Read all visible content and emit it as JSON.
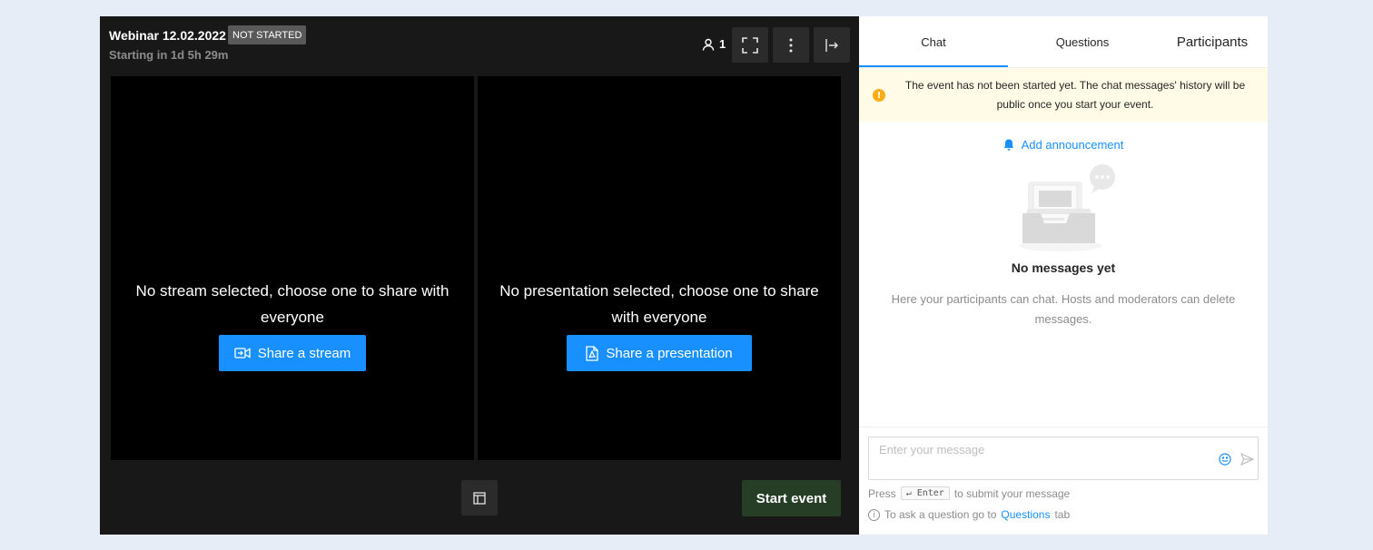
{
  "stage": {
    "title": "Webinar 12.02.2022",
    "status_badge": "NOT STARTED",
    "countdown": "Starting in 1d 5h 29m",
    "viewer_count": "1",
    "stream_pane": {
      "message": "No stream selected, choose one to share with everyone",
      "button": "Share a stream"
    },
    "presentation_pane": {
      "message": "No presentation selected, choose one to share with everyone",
      "button": "Share a presentation"
    },
    "start_button": "Start event"
  },
  "panel": {
    "tabs": [
      {
        "label": "Chat",
        "active": true
      },
      {
        "label": "Questions",
        "active": false
      },
      {
        "label": "Participants",
        "active": false
      }
    ],
    "warning": "The event has not been started yet. The chat messages' history will be public once you start your event.",
    "announcement": "Add announcement",
    "empty_title": "No messages yet",
    "empty_description": "Here your participants can chat. Hosts and moderators can delete messages.",
    "composer": {
      "placeholder": "Enter your message",
      "value": ""
    },
    "hint": {
      "press": "Press",
      "key": "↵ Enter",
      "rest": "to submit your message"
    },
    "info": {
      "prefix": "To ask a question go to",
      "link": "Questions",
      "suffix": "tab"
    }
  },
  "colors": {
    "accent": "#1890ff",
    "stage_bg": "#181818",
    "start_button": "#263d26",
    "warning_bg": "#fffbe6",
    "warning_icon": "#faad14"
  },
  "icons": [
    "user-icon",
    "fullscreen-icon",
    "more-vertical-icon",
    "exit-icon",
    "video-share-icon",
    "pdf-file-icon",
    "layout-icon",
    "warning-icon",
    "bell-icon",
    "empty-inbox-illustration",
    "emoji-icon",
    "send-icon",
    "info-icon"
  ]
}
